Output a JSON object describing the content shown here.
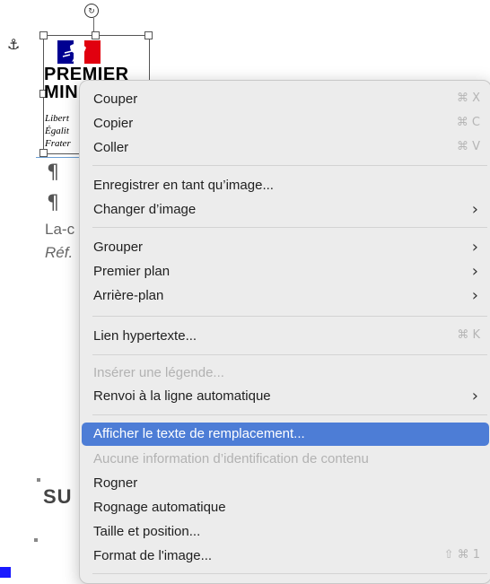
{
  "logo": {
    "line1": "PREMIER",
    "line2": "MIN",
    "motto1": "Libert",
    "motto2": "Égalit",
    "motto3": "Frater"
  },
  "document": {
    "pilcrow": "¶",
    "text_la": "La-c",
    "text_ref": "Réf.",
    "heading": "SU"
  },
  "menu": {
    "couper": "Couper",
    "couper_sc": "⌘ X",
    "copier": "Copier",
    "copier_sc": "⌘ C",
    "coller": "Coller",
    "coller_sc": "⌘ V",
    "enregistrer": "Enregistrer en tant qu’image...",
    "changer": "Changer d’image",
    "grouper": "Grouper",
    "premier_plan": "Premier plan",
    "arriere_plan": "Arrière-plan",
    "lien": "Lien hypertexte...",
    "lien_sc": "⌘ K",
    "inserer": "Insérer une légende...",
    "renvoi": "Renvoi à la ligne automatique",
    "afficher": "Afficher le texte de remplacement...",
    "aucune": "Aucune information d’identification de contenu",
    "rogner": "Rogner",
    "rognage": "Rognage automatique",
    "taille": "Taille et position...",
    "format": "Format de l'image...",
    "format_sc": "⇧ ⌘ 1",
    "chevron": "›"
  },
  "colors": {
    "highlight": "#4d7dd6",
    "menu_bg": "#ececec",
    "flag_blue": "#000091",
    "flag_red": "#e1000f"
  }
}
